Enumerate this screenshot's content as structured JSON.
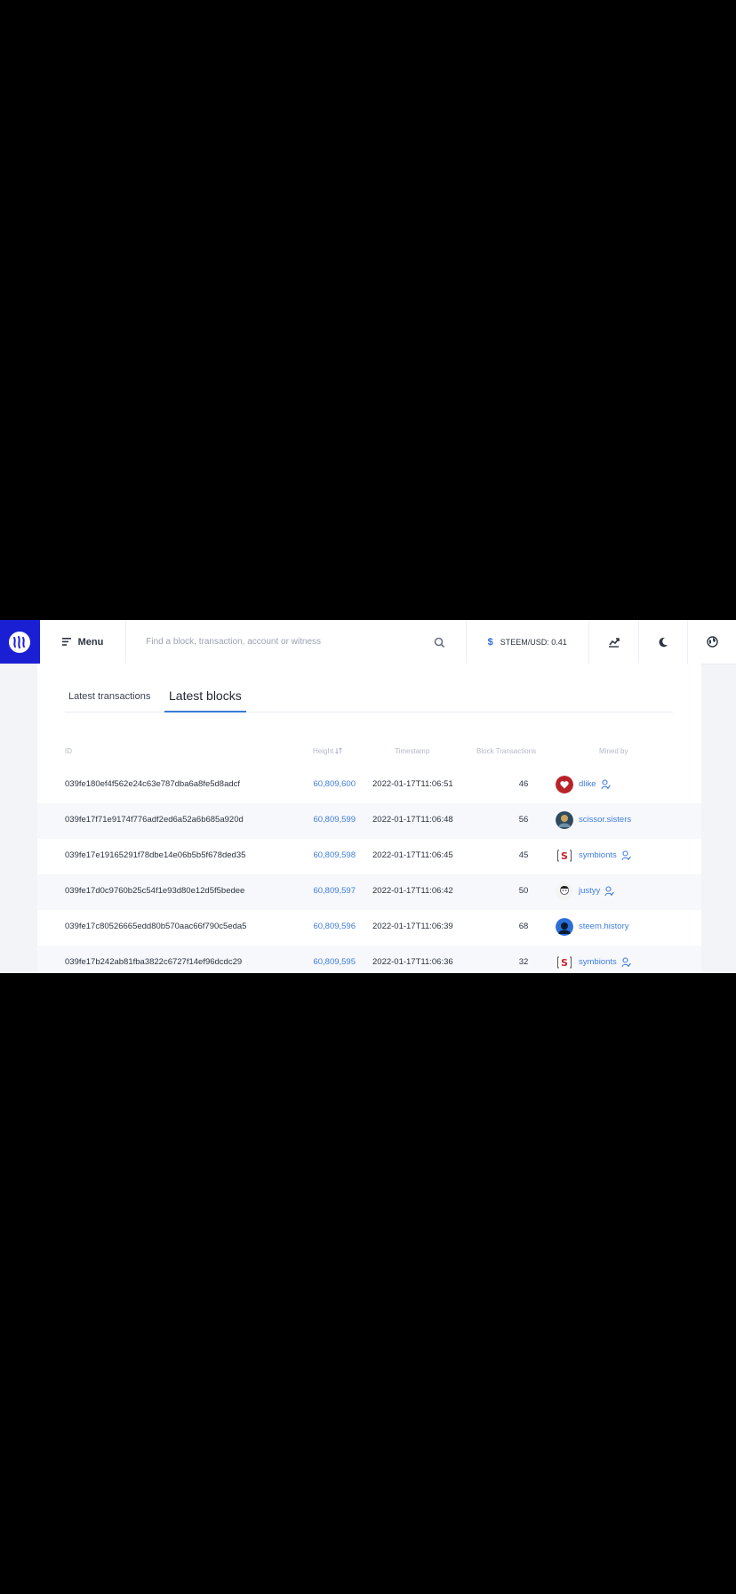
{
  "header": {
    "menu_label": "Menu",
    "search_placeholder": "Find a block, transaction, account or witness",
    "price_label": "STEEM/USD: 0.41"
  },
  "tabs": [
    {
      "label": "Latest transactions",
      "active": false
    },
    {
      "label": "Latest blocks",
      "active": true
    }
  ],
  "table": {
    "columns": [
      "ID",
      "Height",
      "Timestamp",
      "Block Transactions",
      "Mined by"
    ],
    "rows": [
      {
        "id": "039fe180ef4f562e24c63e787dba6a8fe5d8adcf",
        "height": "60,809,600",
        "timestamp": "2022-01-17T11:06:51",
        "tx": "46",
        "miner": "dlike"
      },
      {
        "id": "039fe17f71e9174f776adf2ed6a52a6b685a920d",
        "height": "60,809,599",
        "timestamp": "2022-01-17T11:06:48",
        "tx": "56",
        "miner": "scissor.sisters"
      },
      {
        "id": "039fe17e19165291f78dbe14e06b5b5f678ded35",
        "height": "60,809,598",
        "timestamp": "2022-01-17T11:06:45",
        "tx": "45",
        "miner": "symbionts"
      },
      {
        "id": "039fe17d0c9760b25c54f1e93d80e12d5f5bedee",
        "height": "60,809,597",
        "timestamp": "2022-01-17T11:06:42",
        "tx": "50",
        "miner": "justyy"
      },
      {
        "id": "039fe17c80526665edd80b570aac66f790c5eda5",
        "height": "60,809,596",
        "timestamp": "2022-01-17T11:06:39",
        "tx": "68",
        "miner": "steem.history"
      },
      {
        "id": "039fe17b242ab81fba3822c6727f14ef96dcdc29",
        "height": "60,809,595",
        "timestamp": "2022-01-17T11:06:36",
        "tx": "32",
        "miner": "symbionts"
      }
    ]
  },
  "colors": {
    "brand": "#1a1fd4",
    "link": "#3f7ddc",
    "tab_underline": "#3a7bd5"
  }
}
